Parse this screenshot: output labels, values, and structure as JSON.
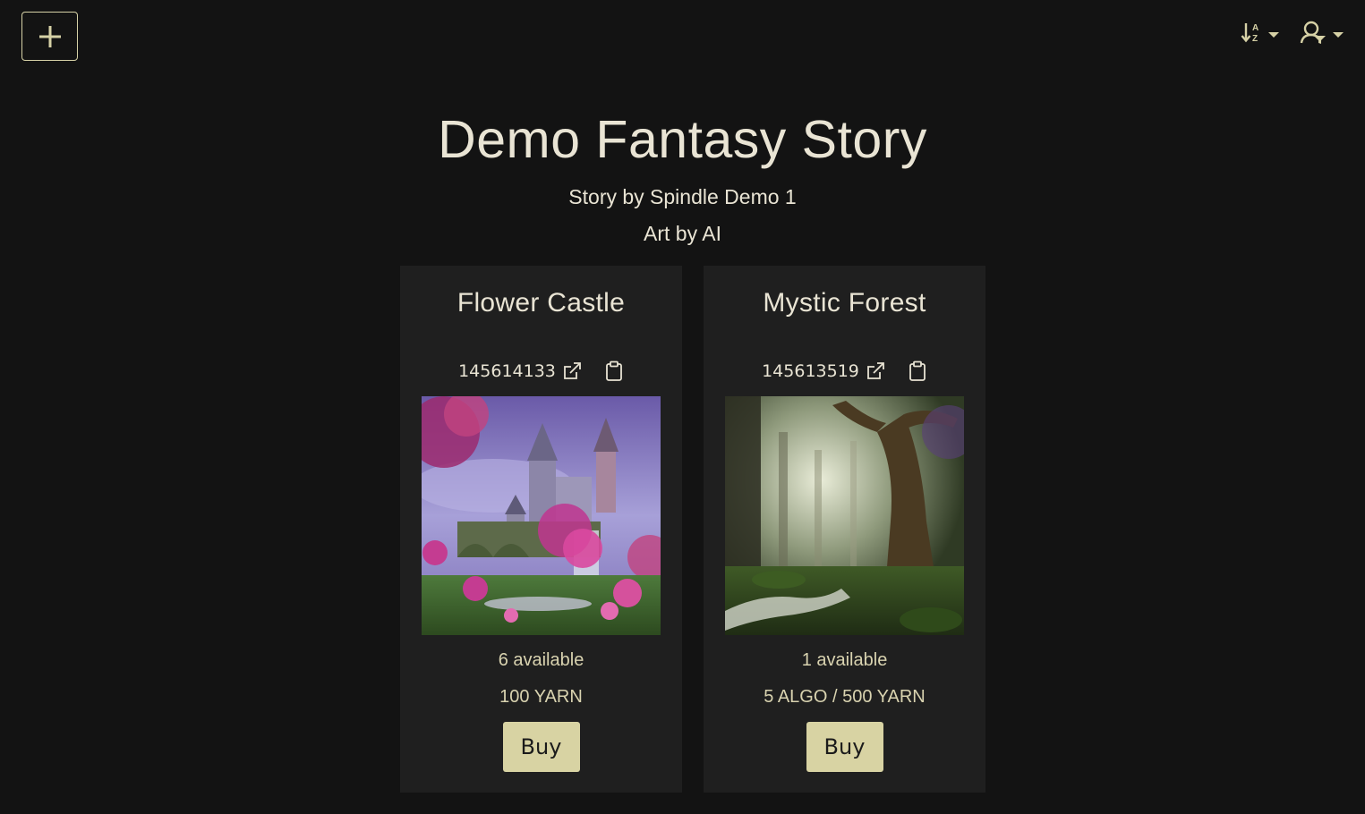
{
  "colors": {
    "background": "#131313",
    "card": "#1f1f1f",
    "accent": "#d8d3a3",
    "text": "#e9e4d4"
  },
  "toolbar": {
    "add_icon": "plus-icon",
    "sort_icon": "sort-alpha-icon",
    "user_icon": "user-search-icon"
  },
  "header": {
    "title": "Demo Fantasy Story",
    "subtitle": "Story by Spindle Demo 1",
    "art_credit": "Art by AI"
  },
  "cards": [
    {
      "title": "Flower Castle",
      "asset_id": "145614133",
      "image_description": "fantasy castle with pink flowers and waterfall",
      "available": "6 available",
      "price": "100 YARN",
      "buy_label": "Buy"
    },
    {
      "title": "Mystic Forest",
      "asset_id": "145613519",
      "image_description": "misty forest with large tree and stream",
      "available": "1 available",
      "price": "5 ALGO / 500 YARN",
      "buy_label": "Buy"
    }
  ]
}
